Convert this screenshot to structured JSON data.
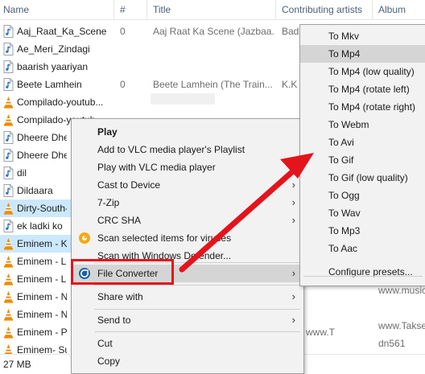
{
  "columns": {
    "name": "Name",
    "number": "#",
    "title": "Title",
    "artists": "Contributing artists",
    "album": "Album"
  },
  "files": [
    {
      "name": "Aaj_Raat_Ka_Scene",
      "num": "0",
      "title": "Aaj Raat Ka Scene (Jazbaa...",
      "artist": "Bads",
      "type": "audio"
    },
    {
      "name": "Ae_Meri_Zindagi",
      "num": "",
      "title": "",
      "artist": "",
      "type": "audio"
    },
    {
      "name": "baarish yaariyan",
      "num": "",
      "title": "",
      "artist": "",
      "type": "audio"
    },
    {
      "name": "Beete Lamhein",
      "num": "0",
      "title": "Beete Lamhein (The Train...",
      "artist": "K.K &",
      "type": "audio"
    },
    {
      "name": "Compilado-youtub...",
      "num": "",
      "title": "",
      "artist": "",
      "type": "vlc"
    },
    {
      "name": "Compilado-youtub...",
      "num": "",
      "title": "",
      "artist": "",
      "type": "vlc"
    },
    {
      "name": "Dheere Dheer",
      "num": "",
      "title": "",
      "artist": "",
      "type": "audio"
    },
    {
      "name": "Dheere Dheer",
      "num": "",
      "title": "",
      "artist": "",
      "type": "audio"
    },
    {
      "name": "dil",
      "num": "",
      "title": "",
      "artist": "",
      "type": "audio"
    },
    {
      "name": "Dildaara",
      "num": "",
      "title": "",
      "artist": "",
      "type": "audio"
    },
    {
      "name": "Dirty-South-",
      "num": "",
      "title": "",
      "artist": "",
      "type": "vlc"
    },
    {
      "name": "ek ladki ko",
      "num": "",
      "title": "",
      "artist": "",
      "type": "audio"
    },
    {
      "name": "Eminem - Ki",
      "num": "",
      "title": "",
      "artist": "",
      "type": "vlc"
    },
    {
      "name": "Eminem - Lo",
      "num": "",
      "title": "",
      "artist": "",
      "type": "vlc"
    },
    {
      "name": "Eminem - Lo",
      "num": "",
      "title": "",
      "artist": "",
      "type": "vlc"
    },
    {
      "name": "Eminem - N",
      "num": "",
      "title": "",
      "artist": "",
      "type": "vlc"
    },
    {
      "name": "Eminem - N",
      "num": "",
      "title": "",
      "artist": "",
      "type": "vlc"
    },
    {
      "name": "Eminem - Ph",
      "num": "",
      "title": "www.T",
      "artist": "",
      "type": "vlc"
    },
    {
      "name": "Eminem- Su",
      "num": "",
      "title": "",
      "artist": "",
      "type": "vlc"
    }
  ],
  "album_peek": {
    "r15": "www.music",
    "r17": "www.Takse",
    "r18": "dn561"
  },
  "status": {
    "size": "27 MB"
  },
  "context_menu": {
    "play": "Play",
    "add_playlist": "Add to VLC media player's Playlist",
    "play_vlc": "Play with VLC media player",
    "cast": "Cast to Device",
    "zip": "7-Zip",
    "crc": "CRC SHA",
    "scan_viruses": "Scan selected items for viruses",
    "scan_defender": "Scan with Windows Defender...",
    "file_converter": "File Converter",
    "share": "Share with",
    "send_to": "Send to",
    "cut": "Cut",
    "copy": "Copy"
  },
  "submenu": {
    "items": [
      "To Mkv",
      "To Mp4",
      "To Mp4 (low quality)",
      "To Mp4 (rotate left)",
      "To Mp4 (rotate right)",
      "To Webm",
      "To Avi",
      "To Gif",
      "To Gif (low quality)",
      "To Ogg",
      "To Wav",
      "To Mp3",
      "To Aac"
    ],
    "configure": "Configure presets..."
  },
  "colors": {
    "selection": "#cce8ff",
    "menu_bg": "#f2f2f2",
    "menu_hover": "#d5d5d5",
    "annotation": "#e3141c",
    "vlc_orange": "#f08a00",
    "avast_orange": "#f7a80d",
    "converter_blue": "#1f5fa8"
  }
}
